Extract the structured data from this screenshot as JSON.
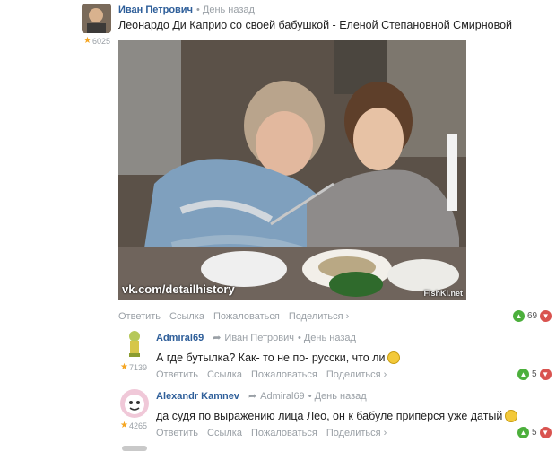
{
  "post": {
    "author": "Иван Петрович",
    "time": "• День назад",
    "rating": "6025",
    "text": "Леонардо Ди Каприо со своей бабушкой - Еленой Степановной Смирновой",
    "photo_watermark_left": "vk.com/detailhistory",
    "photo_watermark_right": "FishKi.net",
    "actions": [
      "Ответить",
      "Ссылка",
      "Пожаловаться",
      "Поделиться ›"
    ],
    "votes": "69"
  },
  "comments": [
    {
      "author": "Admiral69",
      "reply_to": "Иван Петрович",
      "time": "• День назад",
      "rating": "7139",
      "text": "А где бутылка? Как- то не по- русски, что ли",
      "actions": [
        "Ответить",
        "Ссылка",
        "Пожаловаться",
        "Поделиться ›"
      ],
      "votes": "5"
    },
    {
      "author": "Alexandr Kamnev",
      "reply_to": "Admiral69",
      "time": "• День назад",
      "rating": "4265",
      "text": "да судя по выражению лица Лео, он к бабуле припёрся уже датый",
      "actions": [
        "Ответить",
        "Ссылка",
        "Пожаловаться",
        "Поделиться ›"
      ],
      "votes": "5"
    }
  ],
  "colors": {
    "author": "#2f5f9a",
    "muted": "#9aa0a6",
    "upvote": "#4caf3c",
    "downvote": "#d9534f",
    "star": "#f5a623"
  }
}
